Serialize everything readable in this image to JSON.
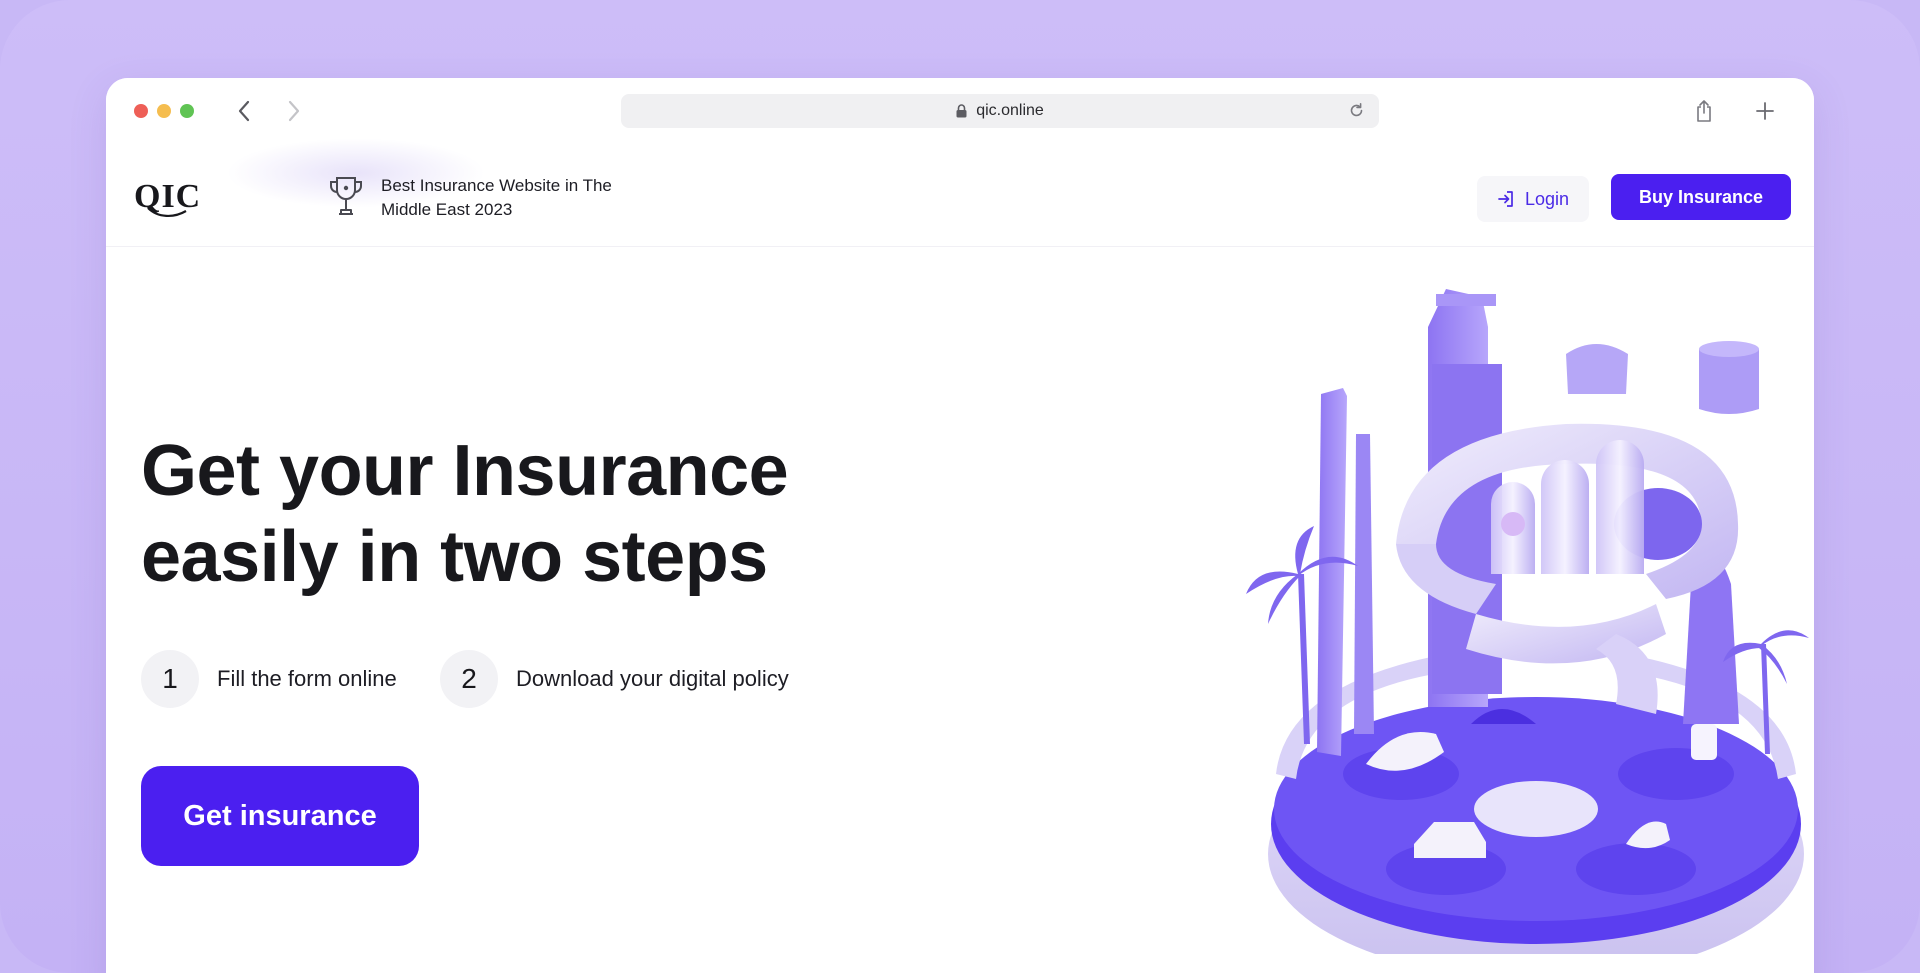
{
  "browser": {
    "url": "qic.online"
  },
  "header": {
    "logo_text": "QIC",
    "award_line1": "Best Insurance Website in The",
    "award_line2": "Middle East 2023",
    "login_label": "Login",
    "buy_label": "Buy Insurance"
  },
  "hero": {
    "title_line1": "Get your Insurance",
    "title_line2": "easily in two steps",
    "steps": [
      {
        "number": "1",
        "label": "Fill the form online"
      },
      {
        "number": "2",
        "label": "Download your digital policy"
      }
    ],
    "cta_label": "Get insurance"
  },
  "colors": {
    "accent": "#4b1ff0",
    "backdrop": "#c8b8f6",
    "text": "#18181c"
  },
  "icons": [
    "back-arrow-icon",
    "forward-arrow-icon",
    "lock-icon",
    "reload-icon",
    "share-icon",
    "plus-icon",
    "trophy-icon",
    "login-icon"
  ]
}
